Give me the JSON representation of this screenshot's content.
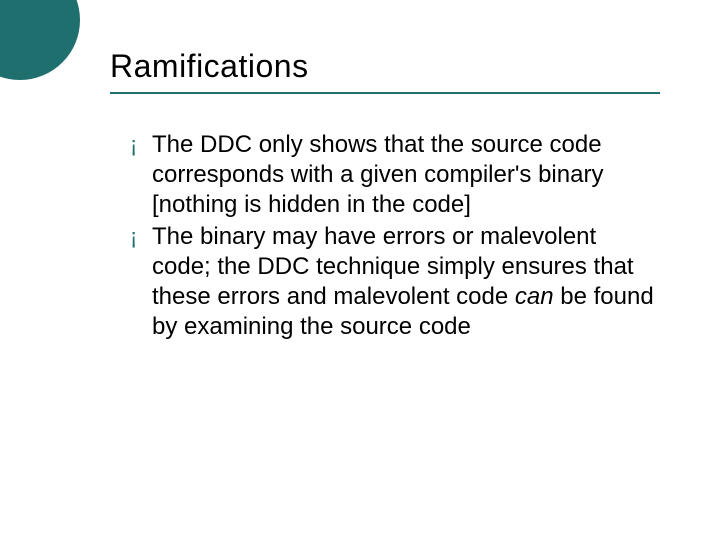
{
  "slide": {
    "title": "Ramifications",
    "bullets": [
      {
        "text_before": "The DDC only shows that the source code corresponds with a given compiler's binary [nothing is hidden in the code]",
        "text_italic": "",
        "text_after": ""
      },
      {
        "text_before": "The binary may have errors or malevolent code; the DDC technique simply ensures that these errors and malevolent code ",
        "text_italic": "can",
        "text_after": " be found by examining the source code"
      }
    ],
    "bullet_glyph": "¡"
  },
  "colors": {
    "accent": "#1f6f6f"
  }
}
